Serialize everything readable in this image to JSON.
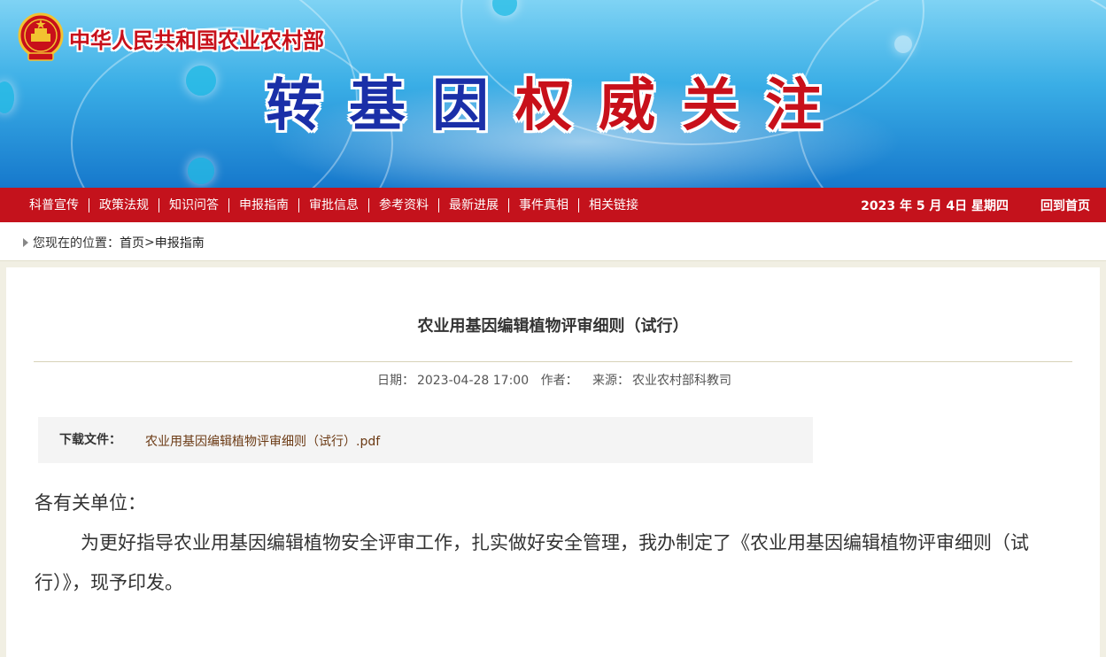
{
  "banner": {
    "ministry": "中华人民共和国农业农村部",
    "slogan": [
      "转",
      "基",
      "因",
      "权",
      "威",
      "关",
      "注"
    ],
    "colors": {
      "ministry": "#c8101a",
      "slogan_blue": "#1a2fa8",
      "slogan_red": "#c8101a"
    }
  },
  "nav": {
    "items": [
      "科普宣传",
      "政策法规",
      "知识问答",
      "申报指南",
      "审批信息",
      "参考资料",
      "最新进展",
      "事件真相",
      "相关链接"
    ],
    "date": "2023 年 5 月 4日   星期四",
    "home": "回到首页",
    "color": "#c4121c"
  },
  "breadcrumb": {
    "prefix": "您现在的位置：",
    "home": "首页",
    "sep": ">",
    "current": "申报指南"
  },
  "article": {
    "title": "农业用基因编辑植物评审细则（试行）",
    "date_label": "日期：",
    "date": "2023-04-28 17:00",
    "author_label": "作者：",
    "author": "",
    "source_label": "来源：",
    "source": "农业农村部科教司",
    "download_label": "下载文件：",
    "download_file": "农业用基因编辑植物评审细则（试行）.pdf",
    "salutation": "各有关单位：",
    "paragraph": "为更好指导农业用基因编辑植物安全评审工作，扎实做好安全管理，我办制定了《农业用基因编辑植物评审细则（试行）》，现予印发。"
  }
}
